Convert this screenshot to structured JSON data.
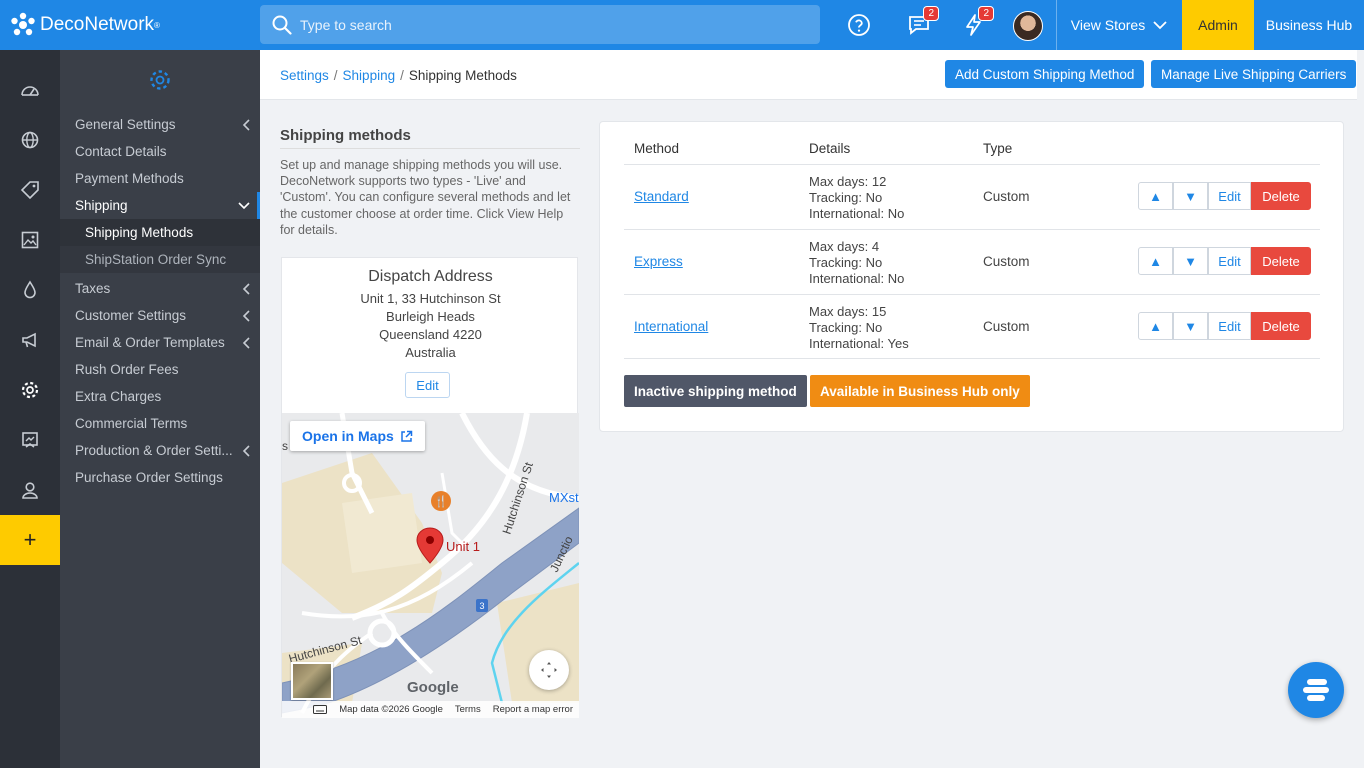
{
  "app": {
    "logo_text": "DecoNetwork",
    "logo_mark": "®"
  },
  "topbar": {
    "search_placeholder": "Type to search",
    "messages_count": "2",
    "notifications_count": "2",
    "view_stores": "View Stores",
    "admin": "Admin",
    "business_hub": "Business Hub"
  },
  "rail": [
    "dashboard-icon",
    "globe-icon",
    "tag-icon",
    "image-icon",
    "drop-icon",
    "megaphone-icon",
    "gear-icon",
    "board-icon",
    "user-icon"
  ],
  "rail_plus": "+",
  "sidebar": {
    "items": [
      {
        "label": "General Settings"
      },
      {
        "label": "Contact Details"
      },
      {
        "label": "Payment Methods"
      },
      {
        "label": "Shipping"
      },
      {
        "label": "Shipping Methods"
      },
      {
        "label": "ShipStation Order Sync"
      },
      {
        "label": "Taxes"
      },
      {
        "label": "Customer Settings"
      },
      {
        "label": "Email & Order Templates"
      },
      {
        "label": "Rush Order Fees"
      },
      {
        "label": "Extra Charges"
      },
      {
        "label": "Commercial Terms"
      },
      {
        "label": "Production & Order Setti..."
      },
      {
        "label": "Purchase Order Settings"
      }
    ]
  },
  "breadcrumb": {
    "items": [
      "Settings",
      "Shipping",
      "Shipping Methods"
    ],
    "separator": "/"
  },
  "header_buttons": {
    "add_custom": "Add Custom Shipping Method",
    "manage_live": "Manage Live Shipping Carriers"
  },
  "info": {
    "title": "Shipping methods",
    "description": "Set up and manage shipping methods you will use. DecoNetwork supports two types - 'Live' and 'Custom'. You can configure several methods and let the customer choose at order time. Click View Help for details."
  },
  "dispatch": {
    "title": "Dispatch Address",
    "lines": [
      "Unit 1, 33 Hutchinson St",
      "Burleigh Heads",
      "Queensland 4220",
      "Australia"
    ],
    "edit": "Edit"
  },
  "map": {
    "open_in_maps": "Open in Maps",
    "marker_label": "Unit 1",
    "street_1": "Hutchinson St",
    "street_2": "Hutchinson St",
    "street_3": "Junctio",
    "place_label": "MXst",
    "route_badge": "3",
    "left_edge_label": "s",
    "google": "Google",
    "footer": [
      "Map data ©2026 Google",
      "Terms",
      "Report a map error"
    ]
  },
  "table": {
    "headers": [
      "Method",
      "Details",
      "Type"
    ],
    "rows": [
      {
        "method": "Standard",
        "details": [
          "Max days: 12",
          "Tracking: No",
          "International: No"
        ],
        "type": "Custom"
      },
      {
        "method": "Express",
        "details": [
          "Max days: 4",
          "Tracking: No",
          "International: No"
        ],
        "type": "Custom"
      },
      {
        "method": "International",
        "details": [
          "Max days: 15",
          "Tracking: No",
          "International: Yes"
        ],
        "type": "Custom"
      }
    ],
    "up": "▲",
    "down": "▼",
    "edit": "Edit",
    "delete": "Delete"
  },
  "legend": {
    "inactive": "Inactive shipping method",
    "business_hub": "Available in Business Hub only"
  },
  "colors": {
    "brand_blue": "#1f87e5",
    "admin_yellow": "#fecb00",
    "delete_red": "#e8493e",
    "inactive": "#505768",
    "hub_orange": "#f08c13"
  }
}
